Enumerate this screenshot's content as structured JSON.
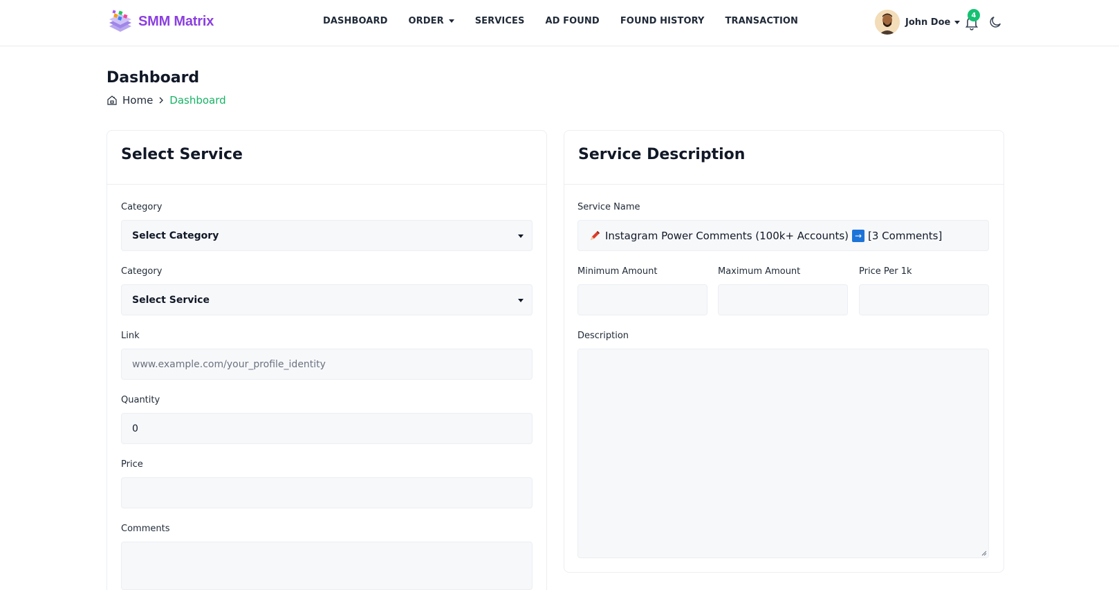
{
  "brand": {
    "name": "SMM Matrix"
  },
  "nav": {
    "items": [
      {
        "label": "DASHBOARD"
      },
      {
        "label": "ORDER"
      },
      {
        "label": "SERVICES"
      },
      {
        "label": "AD FOUND"
      },
      {
        "label": "FOUND HISTORY"
      },
      {
        "label": "TRANSACTION"
      }
    ]
  },
  "user": {
    "name": "John Doe",
    "notifications": "4"
  },
  "page": {
    "title": "Dashboard",
    "breadcrumb": {
      "home": "Home",
      "current": "Dashboard"
    }
  },
  "select_service": {
    "title": "Select Service",
    "category_label": "Category",
    "category_value": "Select Category",
    "service_label": "Category",
    "service_value": "Select Service",
    "link_label": "Link",
    "link_placeholder": "www.example.com/your_profile_identity",
    "quantity_label": "Quantity",
    "quantity_value": "0",
    "price_label": "Price",
    "price_value": "",
    "comments_label": "Comments"
  },
  "service_description": {
    "title": "Service Description",
    "service_name_label": "Service Name",
    "service_name_text": "Instagram Power Comments (100k+ Accounts)",
    "service_name_suffix": "[3 Comments]",
    "min_label": "Minimum Amount",
    "max_label": "Maximum Amount",
    "price_label": "Price Per 1k",
    "description_label": "Description"
  },
  "colors": {
    "accent": "#16b364",
    "brand": "#8b3fe0",
    "badge": "#16c172"
  },
  "icons": [
    "logo-icon",
    "chevron-down-icon",
    "avatar",
    "bell-icon",
    "moon-icon",
    "home-icon",
    "chevron-right-icon",
    "pencil-icon",
    "arrow-right-icon"
  ]
}
